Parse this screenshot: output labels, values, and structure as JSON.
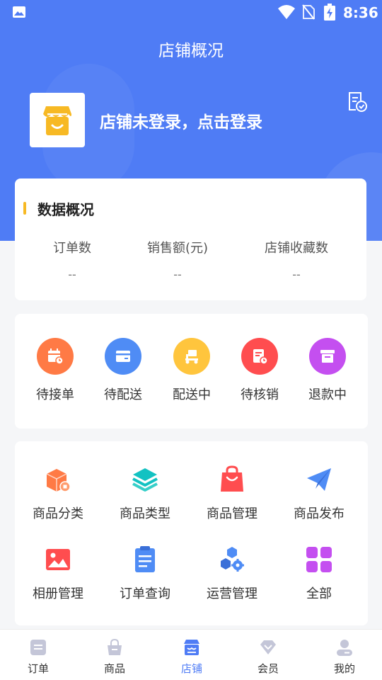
{
  "status_bar": {
    "time": "8:36",
    "icons": [
      "image-icon",
      "wifi-icon",
      "no-sim-icon",
      "battery-charging-icon"
    ]
  },
  "header": {
    "title": "店铺概况"
  },
  "store": {
    "login_prompt": "店铺未登录，点击登录",
    "logo_icon": "store-icon",
    "action_icon": "verify-document-icon"
  },
  "overview": {
    "title": "数据概况",
    "stats": [
      {
        "label": "订单数",
        "value": "--"
      },
      {
        "label": "销售额(元)",
        "value": "--"
      },
      {
        "label": "店铺收藏数",
        "value": "--"
      }
    ]
  },
  "order_status": [
    {
      "label": "待接单",
      "icon": "calendar-clock-icon",
      "color": "#ff7a45"
    },
    {
      "label": "待配送",
      "icon": "card-icon",
      "color": "#4f8cf5"
    },
    {
      "label": "配送中",
      "icon": "scooter-icon",
      "color": "#ffc53d"
    },
    {
      "label": "待核销",
      "icon": "document-clock-icon",
      "color": "#ff4d4f"
    },
    {
      "label": "退款中",
      "icon": "archive-box-icon",
      "color": "#c44ff0"
    }
  ],
  "tools": [
    {
      "label": "商品分类",
      "icon": "box-icon",
      "color": "#ff7a45"
    },
    {
      "label": "商品类型",
      "icon": "layers-icon",
      "color": "#13c2c2"
    },
    {
      "label": "商品管理",
      "icon": "shopping-bag-icon",
      "color": "#ff4d4f"
    },
    {
      "label": "商品发布",
      "icon": "paper-plane-icon",
      "color": "#4f8cf5"
    },
    {
      "label": "相册管理",
      "icon": "image-album-icon",
      "color": "#ff4d4f"
    },
    {
      "label": "订单查询",
      "icon": "clipboard-icon",
      "color": "#4f8cf5"
    },
    {
      "label": "运营管理",
      "icon": "hexagon-gear-icon",
      "color": "#4f8cf5"
    },
    {
      "label": "全部",
      "icon": "grid-icon",
      "color": "#c44ff0"
    }
  ],
  "tabbar": {
    "active": "店铺",
    "active_color": "#4f7cf5",
    "tabs": [
      {
        "label": "订单",
        "icon": "order-tab-icon"
      },
      {
        "label": "商品",
        "icon": "goods-tab-icon"
      },
      {
        "label": "店铺",
        "icon": "store-tab-icon"
      },
      {
        "label": "会员",
        "icon": "member-tab-icon"
      },
      {
        "label": "我的",
        "icon": "profile-tab-icon"
      }
    ]
  }
}
